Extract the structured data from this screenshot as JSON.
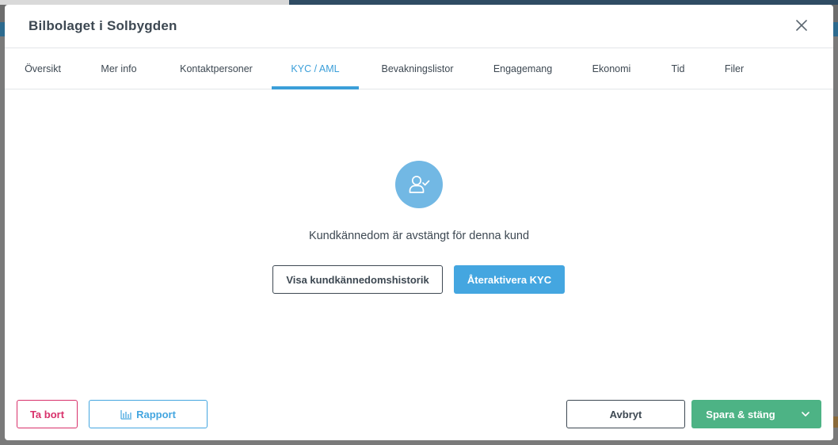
{
  "modal": {
    "title": "Bilbolaget i Solbygden"
  },
  "tabs": [
    {
      "label": "Översikt",
      "active": false
    },
    {
      "label": "Mer info",
      "active": false
    },
    {
      "label": "Kontaktpersoner",
      "active": false
    },
    {
      "label": "KYC / AML",
      "active": true
    },
    {
      "label": "Bevakningslistor",
      "active": false
    },
    {
      "label": "Engagemang",
      "active": false
    },
    {
      "label": "Ekonomi",
      "active": false
    },
    {
      "label": "Tid",
      "active": false
    },
    {
      "label": "Filer",
      "active": false
    }
  ],
  "kyc": {
    "icon": "user-check-icon",
    "message": "Kundkännedom är avstängt för denna kund",
    "history_button": "Visa kundkännedomshistorik",
    "reactivate_button": "Återaktivera KYC"
  },
  "footer": {
    "delete_button": "Ta bort",
    "report_button": "Rapport",
    "report_icon": "bar-chart-icon",
    "cancel_button": "Avbryt",
    "save_button": "Spara & stäng",
    "save_dropdown_icon": "chevron-down-icon"
  },
  "colors": {
    "accent": "#3b9fd9",
    "primary_button": "#44a6e0",
    "success": "#4db385",
    "danger": "#d8316b",
    "text": "#3d4852",
    "icon_circle": "#72b8e4"
  }
}
